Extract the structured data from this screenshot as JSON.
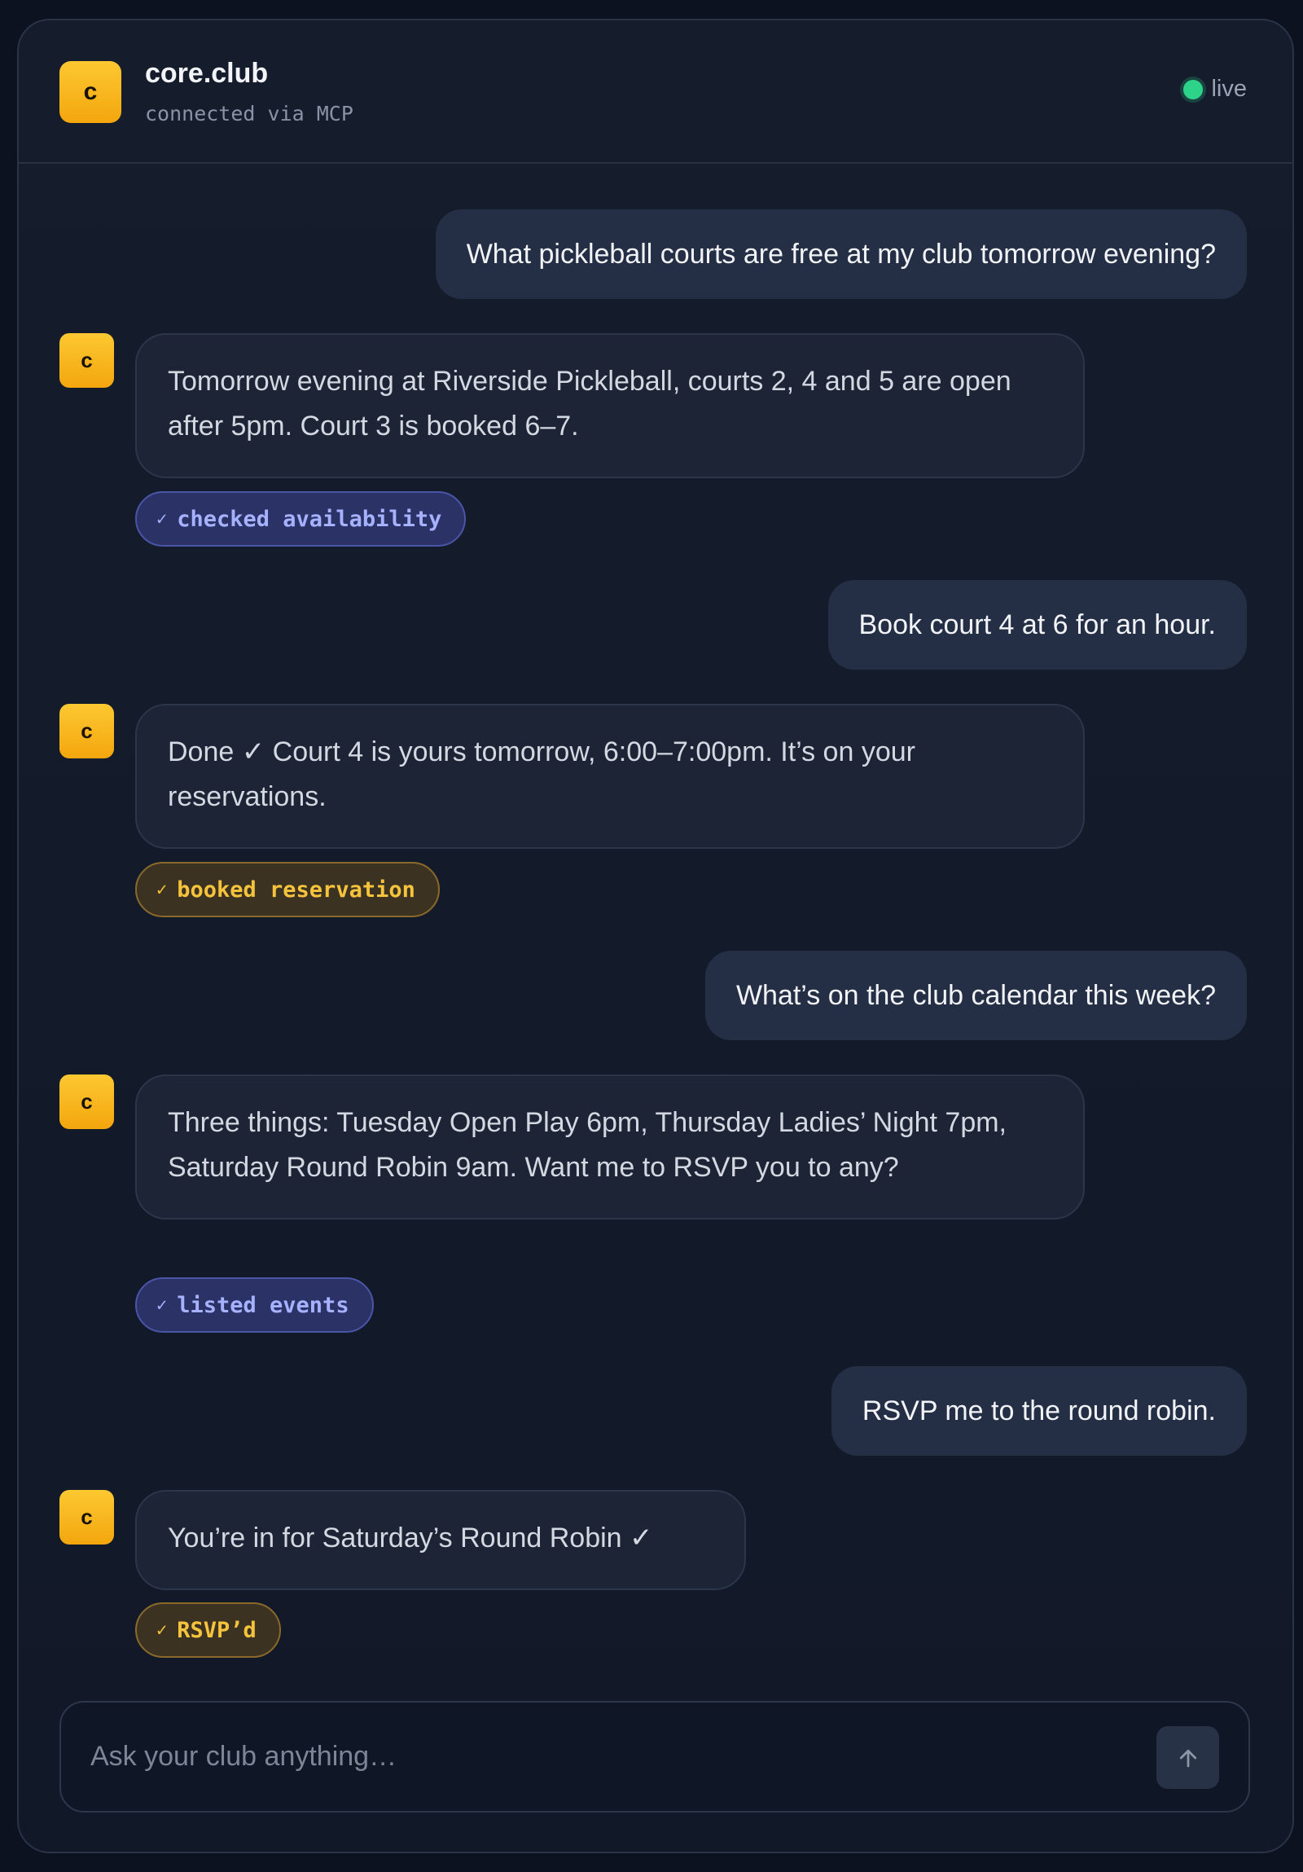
{
  "header": {
    "logo_letter": "c",
    "title": "core.club",
    "subtitle": "connected via MCP",
    "status": "live",
    "status_color": "#2dd388"
  },
  "avatar_letter": "c",
  "messages": [
    {
      "role": "user",
      "text": "What pickleball courts are free at my club tomorrow evening?"
    },
    {
      "role": "assistant",
      "text": "Tomorrow evening at Riverside Pickleball, courts 2, 4 and 5 are open after 5pm. Court 3 is booked 6–7.",
      "tool": {
        "label": "checked availability",
        "color": "blue",
        "icon": "check-icon"
      }
    },
    {
      "role": "user",
      "text": "Book court 4 at 6 for an hour."
    },
    {
      "role": "assistant",
      "text": "Done ✓ Court 4 is yours tomorrow, 6:00–7:00pm. It’s on your reservations.",
      "tool": {
        "label": "booked reservation",
        "color": "amber",
        "icon": "check-icon"
      }
    },
    {
      "role": "user",
      "text": "What’s on the club calendar this week?"
    },
    {
      "role": "assistant",
      "text": "Three things: Tuesday Open Play 6pm, Thursday Ladies’ Night 7pm, Saturday Round Robin 9am. Want me to RSVP you to any?",
      "tool": {
        "label": "listed events",
        "color": "blue",
        "icon": "check-icon"
      }
    },
    {
      "role": "user",
      "text": "RSVP me to the round robin."
    },
    {
      "role": "assistant",
      "text": "You’re in for Saturday’s Round Robin ✓",
      "tool": {
        "label": "RSVP’d",
        "color": "amber",
        "icon": "check-icon"
      }
    }
  ],
  "composer": {
    "placeholder": "Ask your club anything…",
    "send_icon": "arrow-up-icon"
  },
  "colors": {
    "accent": "#f4a60d",
    "tool_blue": "#a6b2ff",
    "tool_amber": "#f6c33c"
  }
}
